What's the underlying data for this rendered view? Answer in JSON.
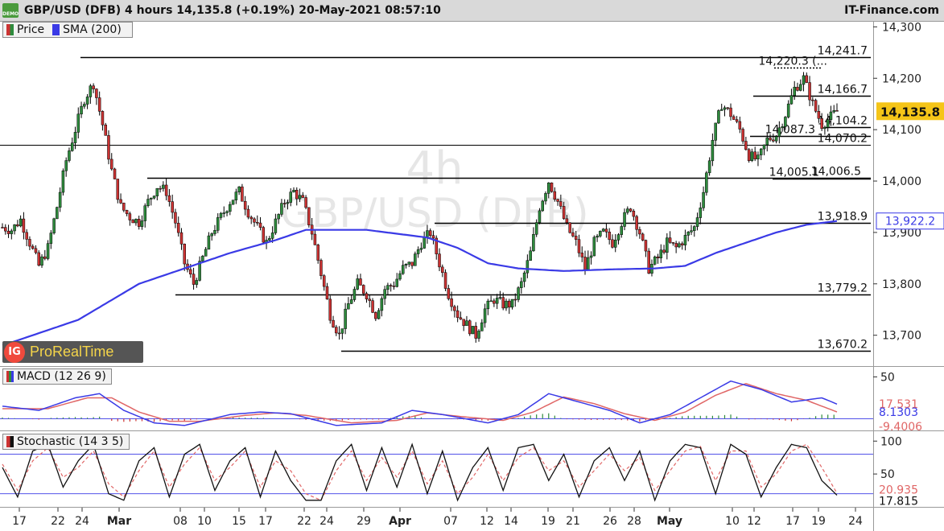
{
  "header": {
    "demo_badge": "DEMO",
    "title": "GBP/USD (DFB) 4 hours 14,135.8 (+0.19%) 20-May-2021 08:57:10",
    "brand": "IT-Finance.com"
  },
  "legend": {
    "price": "Price",
    "sma": "SMA (200)",
    "macd": "MACD (12 26 9)",
    "stoch": "Stochastic (14 3 5)"
  },
  "watermark": {
    "line1": "4h",
    "line2": "GBP/USD (DFB)"
  },
  "logo": {
    "ig": "IG",
    "text": "ProRealTime"
  },
  "colors": {
    "sma": "#3a3ae6",
    "up": "#2e8b3d",
    "down": "#cc3333",
    "badge_price": "#f5c518",
    "badge_sma": "#3a3ae6",
    "macd_signal": "#e06666"
  },
  "chart_data": [
    {
      "type": "candlestick",
      "name": "price",
      "ylim": [
        13640,
        14310
      ],
      "yticks": [
        {
          "label": "14,300",
          "value": 14300
        },
        {
          "label": "14,200",
          "value": 14200
        },
        {
          "label": "14,100",
          "value": 14100
        },
        {
          "label": "14,000",
          "value": 14000
        },
        {
          "label": "13,900",
          "value": 13900
        },
        {
          "label": "13,800",
          "value": 13800
        },
        {
          "label": "13,700",
          "value": 13700
        }
      ],
      "xticks": [
        "17",
        "22",
        "24",
        "Mar",
        "08",
        "10",
        "15",
        "17",
        "22",
        "24",
        "29",
        "Apr",
        "07",
        "12",
        "14",
        "19",
        "21",
        "26",
        "28",
        "May",
        "10",
        "12",
        "17",
        "19",
        "24"
      ],
      "current_price": {
        "label": "14,135.8",
        "value": 14135.8
      },
      "sma_last": {
        "label": "13,922.2",
        "value": 13922.2
      },
      "levels": [
        {
          "label": "14,241.7",
          "value": 14241.7
        },
        {
          "label": "14,220.3 (...",
          "value": 14220.3
        },
        {
          "label": "14,166.7",
          "value": 14166.7
        },
        {
          "label": "14,104.2",
          "value": 14104.2
        },
        {
          "label": "14,087.3",
          "value": 14087.3
        },
        {
          "label": "14,070.2",
          "value": 14070.2
        },
        {
          "label": "14,005.1",
          "value": 14005.1
        },
        {
          "label": "14,006.5",
          "value": 14006.5
        },
        {
          "label": "13,918.9",
          "value": 13918.9
        },
        {
          "label": "13,779.2",
          "value": 13779.2
        },
        {
          "label": "13,670.2",
          "value": 13670.2
        }
      ],
      "close_path": [
        [
          0,
          13910
        ],
        [
          3,
          13905
        ],
        [
          6,
          13925
        ],
        [
          9,
          13880
        ],
        [
          12,
          13835
        ],
        [
          15,
          13870
        ],
        [
          18,
          13950
        ],
        [
          21,
          14040
        ],
        [
          24,
          14100
        ],
        [
          27,
          14160
        ],
        [
          30,
          14190
        ],
        [
          33,
          14110
        ],
        [
          36,
          14020
        ],
        [
          39,
          13950
        ],
        [
          42,
          13930
        ],
        [
          45,
          13920
        ],
        [
          48,
          13960
        ],
        [
          51,
          13990
        ],
        [
          54,
          13980
        ],
        [
          57,
          13920
        ],
        [
          60,
          13840
        ],
        [
          63,
          13800
        ],
        [
          66,
          13850
        ],
        [
          69,
          13900
        ],
        [
          72,
          13930
        ],
        [
          75,
          13960
        ],
        [
          78,
          13980
        ],
        [
          81,
          13940
        ],
        [
          84,
          13910
        ],
        [
          87,
          13880
        ],
        [
          90,
          13920
        ],
        [
          93,
          13960
        ],
        [
          96,
          13980
        ],
        [
          99,
          13960
        ],
        [
          102,
          13900
        ],
        [
          105,
          13820
        ],
        [
          108,
          13740
        ],
        [
          111,
          13700
        ],
        [
          114,
          13760
        ],
        [
          117,
          13800
        ],
        [
          120,
          13780
        ],
        [
          123,
          13740
        ],
        [
          126,
          13790
        ],
        [
          129,
          13800
        ],
        [
          132,
          13830
        ],
        [
          135,
          13840
        ],
        [
          138,
          13880
        ],
        [
          141,
          13900
        ],
        [
          144,
          13840
        ],
        [
          147,
          13780
        ],
        [
          150,
          13740
        ],
        [
          153,
          13720
        ],
        [
          156,
          13700
        ],
        [
          159,
          13750
        ],
        [
          162,
          13770
        ],
        [
          165,
          13760
        ],
        [
          168,
          13760
        ],
        [
          171,
          13800
        ],
        [
          174,
          13860
        ],
        [
          177,
          13950
        ],
        [
          180,
          14000
        ],
        [
          183,
          13960
        ],
        [
          186,
          13910
        ],
        [
          189,
          13880
        ],
        [
          192,
          13830
        ],
        [
          195,
          13880
        ],
        [
          198,
          13900
        ],
        [
          201,
          13880
        ],
        [
          204,
          13920
        ],
        [
          207,
          13950
        ],
        [
          210,
          13900
        ],
        [
          213,
          13830
        ],
        [
          216,
          13850
        ],
        [
          219,
          13880
        ],
        [
          222,
          13870
        ],
        [
          225,
          13890
        ],
        [
          228,
          13910
        ],
        [
          231,
          13980
        ],
        [
          234,
          14080
        ],
        [
          237,
          14150
        ],
        [
          240,
          14130
        ],
        [
          243,
          14100
        ],
        [
          246,
          14050
        ],
        [
          249,
          14040
        ],
        [
          252,
          14080
        ],
        [
          255,
          14090
        ],
        [
          258,
          14130
        ],
        [
          261,
          14180
        ],
        [
          264,
          14200
        ],
        [
          267,
          14150
        ],
        [
          270,
          14110
        ],
        [
          273,
          14125
        ],
        [
          275,
          14136
        ]
      ],
      "sma_path": [
        [
          0,
          13680
        ],
        [
          25,
          13730
        ],
        [
          45,
          13800
        ],
        [
          60,
          13830
        ],
        [
          75,
          13860
        ],
        [
          90,
          13885
        ],
        [
          100,
          13905
        ],
        [
          120,
          13905
        ],
        [
          140,
          13890
        ],
        [
          150,
          13870
        ],
        [
          160,
          13840
        ],
        [
          170,
          13830
        ],
        [
          185,
          13825
        ],
        [
          200,
          13828
        ],
        [
          215,
          13830
        ],
        [
          225,
          13835
        ],
        [
          235,
          13860
        ],
        [
          245,
          13880
        ],
        [
          255,
          13900
        ],
        [
          265,
          13915
        ],
        [
          275,
          13922.2
        ]
      ]
    },
    {
      "type": "line",
      "name": "macd",
      "ylim": [
        -14,
        62
      ],
      "yticks": [
        {
          "label": "50",
          "value": 50
        }
      ],
      "value_labels": [
        {
          "label": "17.531",
          "value": 17.531
        },
        {
          "label": "8.1303",
          "value": 8.1303
        },
        {
          "label": "-9.4006",
          "value": -9.4006
        }
      ],
      "macd_path": [
        [
          0,
          15
        ],
        [
          12,
          10
        ],
        [
          24,
          25
        ],
        [
          32,
          30
        ],
        [
          40,
          10
        ],
        [
          50,
          -5
        ],
        [
          60,
          -8
        ],
        [
          75,
          5
        ],
        [
          85,
          8
        ],
        [
          95,
          6
        ],
        [
          110,
          -8
        ],
        [
          125,
          -5
        ],
        [
          135,
          10
        ],
        [
          145,
          5
        ],
        [
          160,
          -5
        ],
        [
          170,
          5
        ],
        [
          180,
          30
        ],
        [
          190,
          20
        ],
        [
          200,
          10
        ],
        [
          210,
          -5
        ],
        [
          220,
          5
        ],
        [
          230,
          25
        ],
        [
          240,
          45
        ],
        [
          250,
          35
        ],
        [
          260,
          20
        ],
        [
          270,
          25
        ],
        [
          275,
          17.5
        ]
      ],
      "signal_path": [
        [
          0,
          12
        ],
        [
          15,
          12
        ],
        [
          28,
          25
        ],
        [
          36,
          25
        ],
        [
          45,
          8
        ],
        [
          55,
          -3
        ],
        [
          65,
          -3
        ],
        [
          80,
          4
        ],
        [
          90,
          7
        ],
        [
          100,
          4
        ],
        [
          115,
          -5
        ],
        [
          130,
          -2
        ],
        [
          140,
          7
        ],
        [
          150,
          3
        ],
        [
          165,
          -2
        ],
        [
          175,
          8
        ],
        [
          185,
          26
        ],
        [
          195,
          18
        ],
        [
          205,
          6
        ],
        [
          215,
          -2
        ],
        [
          225,
          8
        ],
        [
          235,
          28
        ],
        [
          245,
          42
        ],
        [
          255,
          30
        ],
        [
          265,
          22
        ],
        [
          275,
          8.1
        ]
      ]
    },
    {
      "type": "line",
      "name": "stochastic",
      "ylim": [
        0,
        115
      ],
      "yticks": [
        {
          "label": "100",
          "value": 100
        },
        {
          "label": "50",
          "value": 50
        }
      ],
      "value_labels": [
        {
          "label": "20.935",
          "value": 20.935
        },
        {
          "label": "17.815",
          "value": 17.815
        }
      ],
      "bands": [
        80,
        20
      ],
      "k_path": [
        [
          0,
          60
        ],
        [
          5,
          15
        ],
        [
          10,
          85
        ],
        [
          15,
          95
        ],
        [
          20,
          30
        ],
        [
          25,
          70
        ],
        [
          30,
          95
        ],
        [
          35,
          20
        ],
        [
          40,
          10
        ],
        [
          45,
          70
        ],
        [
          50,
          90
        ],
        [
          55,
          15
        ],
        [
          60,
          80
        ],
        [
          65,
          95
        ],
        [
          70,
          25
        ],
        [
          75,
          70
        ],
        [
          80,
          90
        ],
        [
          85,
          15
        ],
        [
          90,
          85
        ],
        [
          95,
          40
        ],
        [
          100,
          10
        ],
        [
          105,
          10
        ],
        [
          110,
          70
        ],
        [
          115,
          95
        ],
        [
          120,
          25
        ],
        [
          125,
          90
        ],
        [
          130,
          30
        ],
        [
          135,
          95
        ],
        [
          140,
          20
        ],
        [
          145,
          85
        ],
        [
          150,
          10
        ],
        [
          155,
          60
        ],
        [
          160,
          90
        ],
        [
          165,
          25
        ],
        [
          170,
          90
        ],
        [
          175,
          95
        ],
        [
          180,
          40
        ],
        [
          185,
          80
        ],
        [
          190,
          15
        ],
        [
          195,
          70
        ],
        [
          200,
          90
        ],
        [
          205,
          40
        ],
        [
          210,
          85
        ],
        [
          215,
          10
        ],
        [
          220,
          70
        ],
        [
          225,
          95
        ],
        [
          230,
          90
        ],
        [
          235,
          20
        ],
        [
          240,
          95
        ],
        [
          245,
          80
        ],
        [
          250,
          15
        ],
        [
          255,
          60
        ],
        [
          260,
          95
        ],
        [
          265,
          90
        ],
        [
          270,
          40
        ],
        [
          275,
          17.8
        ]
      ],
      "d_path": [
        [
          0,
          65
        ],
        [
          5,
          25
        ],
        [
          10,
          70
        ],
        [
          15,
          90
        ],
        [
          20,
          45
        ],
        [
          25,
          60
        ],
        [
          30,
          85
        ],
        [
          35,
          35
        ],
        [
          40,
          15
        ],
        [
          45,
          55
        ],
        [
          50,
          85
        ],
        [
          55,
          30
        ],
        [
          60,
          65
        ],
        [
          65,
          90
        ],
        [
          70,
          40
        ],
        [
          75,
          60
        ],
        [
          80,
          85
        ],
        [
          85,
          30
        ],
        [
          90,
          70
        ],
        [
          95,
          55
        ],
        [
          100,
          20
        ],
        [
          105,
          10
        ],
        [
          110,
          55
        ],
        [
          115,
          85
        ],
        [
          120,
          40
        ],
        [
          125,
          75
        ],
        [
          130,
          45
        ],
        [
          135,
          85
        ],
        [
          140,
          35
        ],
        [
          145,
          70
        ],
        [
          150,
          20
        ],
        [
          155,
          45
        ],
        [
          160,
          80
        ],
        [
          165,
          40
        ],
        [
          170,
          75
        ],
        [
          175,
          90
        ],
        [
          180,
          55
        ],
        [
          185,
          70
        ],
        [
          190,
          30
        ],
        [
          195,
          55
        ],
        [
          200,
          80
        ],
        [
          205,
          55
        ],
        [
          210,
          75
        ],
        [
          215,
          25
        ],
        [
          220,
          55
        ],
        [
          225,
          85
        ],
        [
          230,
          92
        ],
        [
          235,
          40
        ],
        [
          240,
          85
        ],
        [
          245,
          85
        ],
        [
          250,
          30
        ],
        [
          255,
          50
        ],
        [
          260,
          85
        ],
        [
          265,
          95
        ],
        [
          270,
          60
        ],
        [
          275,
          20.9
        ]
      ]
    }
  ]
}
